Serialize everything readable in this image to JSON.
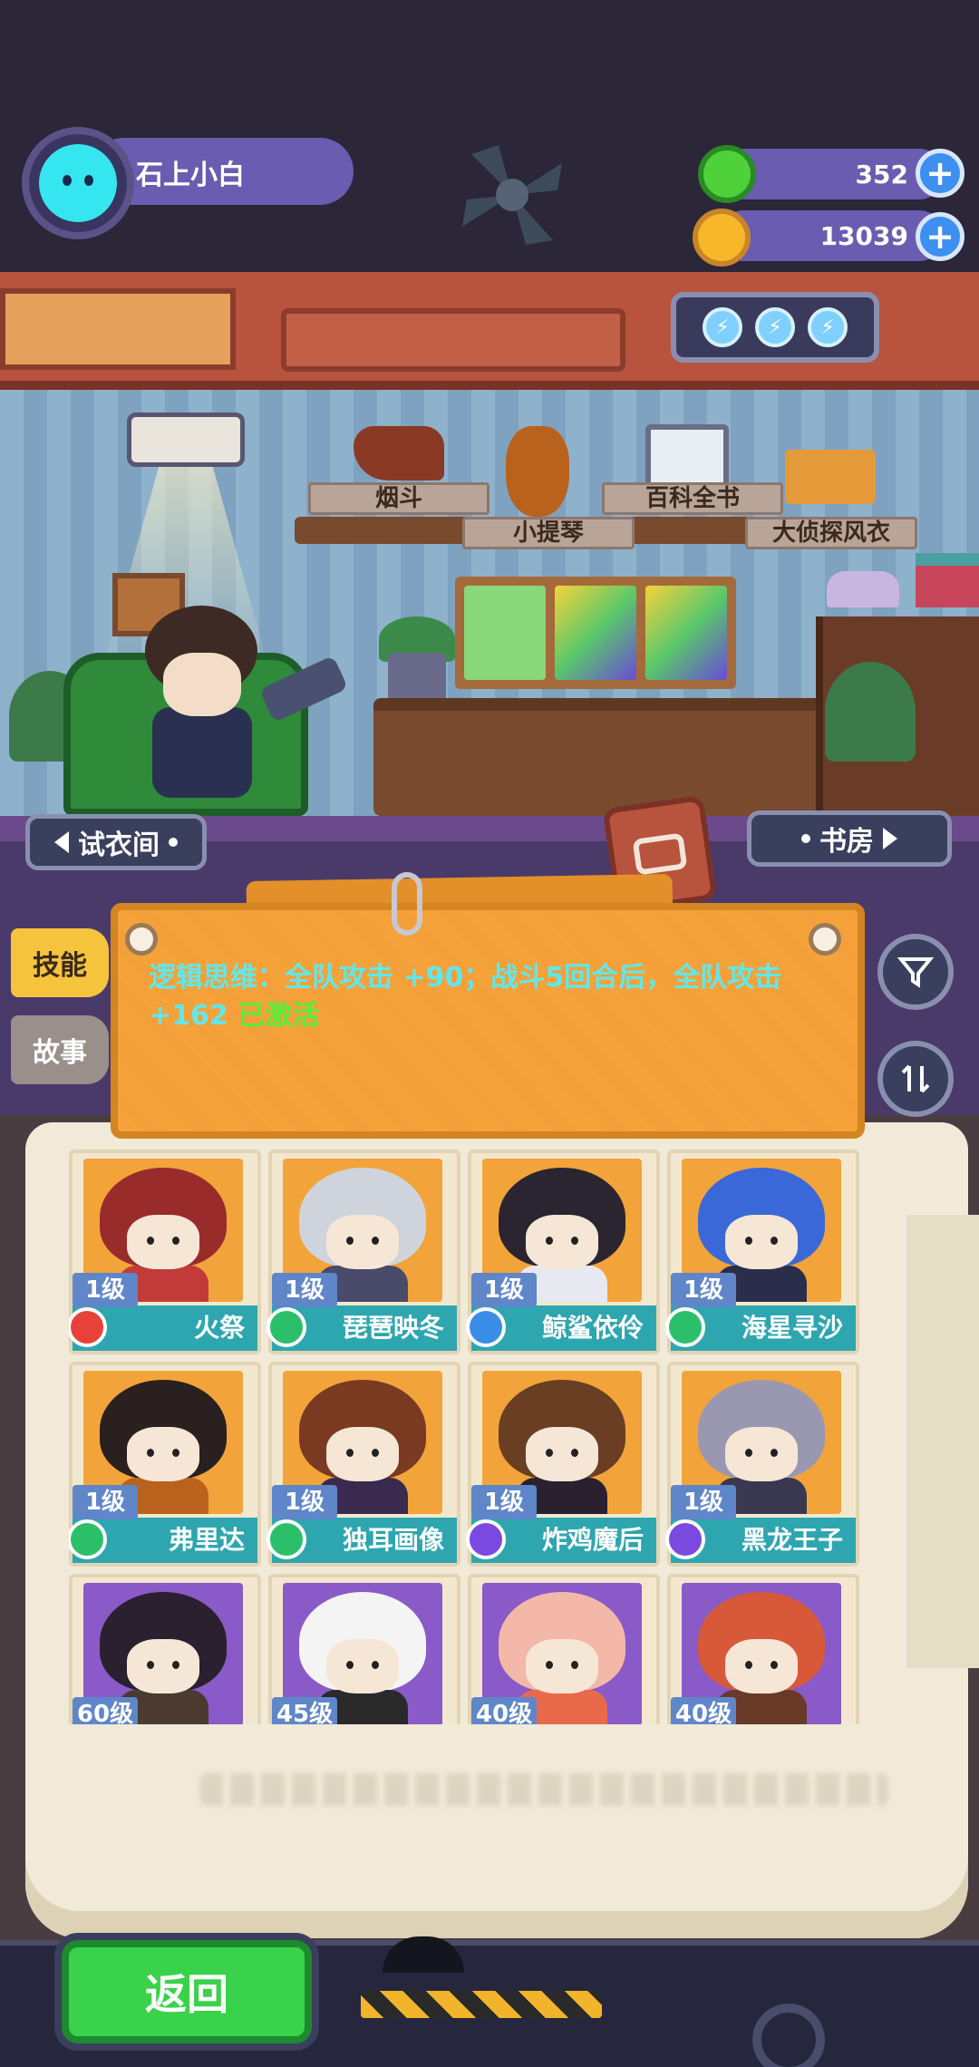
{
  "player": {
    "name": "石上小白"
  },
  "currency": [
    {
      "name": "green-gem",
      "value": "352",
      "color": "#4fd13a"
    },
    {
      "name": "gold-coin",
      "value": "13039",
      "color": "#f6b828"
    }
  ],
  "room": {
    "shelf_items": [
      "烟斗",
      "小提琴",
      "百科全书",
      "大侦探风衣"
    ],
    "nav_left": "试衣间",
    "nav_right": "书房"
  },
  "tabs": {
    "skill": "技能",
    "story": "故事"
  },
  "skill_note": {
    "text": "逻辑思维：全队攻击 +90；战斗5回合后，全队攻击 +162",
    "status": "已激活"
  },
  "characters": [
    {
      "level": "1级",
      "name": "火祭",
      "elem_color": "#e8413a",
      "hair": "#9a2b2b",
      "art_bg": "#f2a43a",
      "body": "#c33a3a"
    },
    {
      "level": "1级",
      "name": "琵琶映冬",
      "elem_color": "#2cbf6a",
      "hair": "#cfd4dc",
      "art_bg": "#f2a43a",
      "body": "#4a4a6a"
    },
    {
      "level": "1级",
      "name": "鲸鲨依伶",
      "elem_color": "#3b8ee8",
      "hair": "#2a2530",
      "art_bg": "#f2a43a",
      "body": "#e8e8f0"
    },
    {
      "level": "1级",
      "name": "海星寻沙",
      "elem_color": "#2cbf6a",
      "hair": "#3b68d8",
      "art_bg": "#f2a43a",
      "body": "#2a2e4a"
    },
    {
      "level": "1级",
      "name": "弗里达",
      "elem_color": "#2cbf6a",
      "hair": "#2a2020",
      "art_bg": "#f2a43a",
      "body": "#b8621e"
    },
    {
      "level": "1级",
      "name": "独耳画像",
      "elem_color": "#2cbf6a",
      "hair": "#7a3a22",
      "art_bg": "#f2a43a",
      "body": "#3a2a50"
    },
    {
      "level": "1级",
      "name": "炸鸡魔后",
      "elem_color": "#7a4ae0",
      "hair": "#6a3e22",
      "art_bg": "#f2a43a",
      "body": "#2a2030"
    },
    {
      "level": "1级",
      "name": "黑龙王子",
      "elem_color": "#7a4ae0",
      "hair": "#9a98b0",
      "art_bg": "#f2a43a",
      "body": "#3a3850"
    },
    {
      "level": "60级",
      "name": "",
      "elem_color": "#2cbf6a",
      "hair": "#2a2030",
      "art_bg": "#8a5ac8",
      "body": "#4a3a30"
    },
    {
      "level": "45级",
      "name": "",
      "elem_color": "#3b8ee8",
      "hair": "#f4f4f4",
      "art_bg": "#8a5ac8",
      "body": "#2a2a2a"
    },
    {
      "level": "40级",
      "name": "",
      "elem_color": "#f6b828",
      "hair": "#f4b8a8",
      "art_bg": "#8a5ac8",
      "body": "#e86a4a"
    },
    {
      "level": "40级",
      "name": "",
      "elem_color": "#7a4ae0",
      "hair": "#d8583a",
      "art_bg": "#8a5ac8",
      "body": "#6a3a28"
    }
  ],
  "bottom": {
    "back_label": "返回"
  },
  "icons": [
    "energy-bolt-icon",
    "filter-icon",
    "sort-icon",
    "clip-card-icon",
    "plus-icon"
  ]
}
